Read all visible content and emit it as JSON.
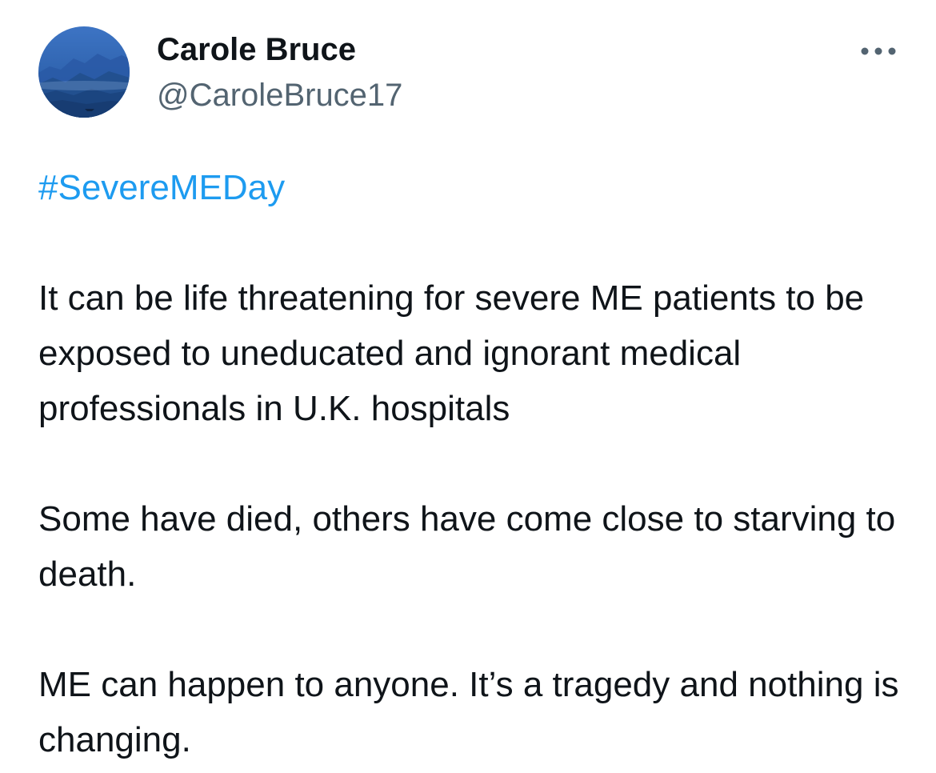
{
  "author": {
    "name": "Carole Bruce",
    "handle": "@CaroleBruce17",
    "avatar_icon": "misty-mountains-avatar"
  },
  "more_icon": "more-horizontal-icon",
  "tweet": {
    "hashtag": "#SevereMEDay",
    "paragraphs": [
      "It can be life threatening for severe ME patients to be exposed to uneducated and ignorant medical professionals in U.K. hospitals",
      "Some have died, others have come close to starving to death.",
      "ME can happen to anyone. It’s a tragedy and nothing is changing."
    ]
  },
  "colors": {
    "text": "#0f1419",
    "secondary": "#536471",
    "link": "#1d9bf0"
  }
}
